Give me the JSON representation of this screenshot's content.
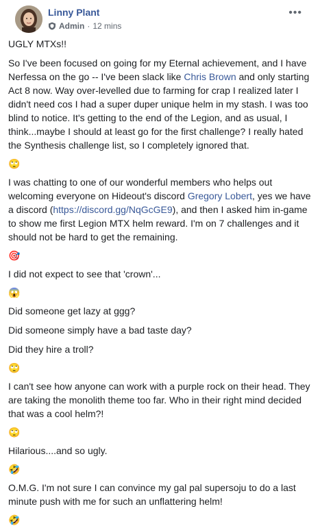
{
  "post": {
    "author": "Linny Plant",
    "role": "Admin",
    "separator": "·",
    "time": "12 mins",
    "more_label": "•••"
  },
  "icons": {
    "avatar": "user-avatar",
    "shield": "admin-shield-icon",
    "more": "more-options-icon",
    "emoji_rolling_eyes": "🙄",
    "emoji_target": "🎯",
    "emoji_scream": "😱",
    "emoji_rofl": "🤣"
  },
  "content": {
    "p1": "UGLY MTXs!!",
    "p2_a": "So I've been focused on going for my Eternal achievement, and I have Nerfessa on the go -- I've been slack like ",
    "p2_link": "Chris Brown",
    "p2_b": " and only starting Act 8 now. Way over-levelled due to farming for crap I realized later I didn't need cos I had a super duper unique helm in my stash. I was too blind to notice. It's getting to the end of the Legion, and as usual, I think...maybe I should at least go for the first challenge? I really hated the Synthesis challenge list, so I completely ignored that.",
    "p3_a": "I was chatting to one of our wonderful members who helps out welcoming everyone on Hideout's discord ",
    "p3_link1": "Gregory Lobert",
    "p3_b": ", yes we have a discord (",
    "p3_link2": "https://discord.gg/NqGcGE9",
    "p3_c": "), and then I asked him in-game to show me first Legion MTX helm reward. I'm on 7 challenges and it should not be hard to get the remaining.",
    "p4": "I did not expect to see that 'crown'...",
    "p5": "Did someone get lazy at ggg?",
    "p6": "Did someone simply have a bad taste day?",
    "p7": "Did they hire a troll?",
    "p8": "I can't see how anyone can work with a purple rock on their head. They are taking the monolith theme too far. Who in their right mind decided that was a cool helm?!",
    "p9": "Hilarious....and so ugly.",
    "p10": "O.M.G. I'm not sure I can convince my gal pal supersoju to do a last minute push with me for such an unflattering helm!"
  },
  "colors": {
    "link": "#385898",
    "text": "#1c1e21",
    "meta": "#606770"
  }
}
